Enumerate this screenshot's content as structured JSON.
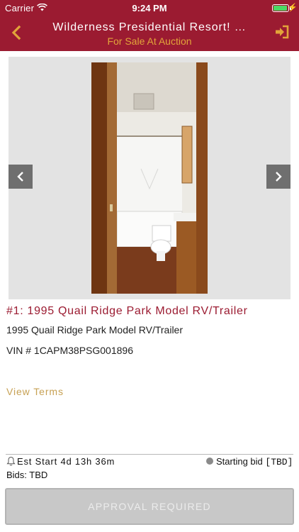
{
  "status_bar": {
    "carrier": "Carrier",
    "time": "9:24 PM"
  },
  "nav": {
    "title": "Wilderness Presidential Resort! …",
    "subtitle": "For Sale At Auction",
    "icons": {
      "back": "chevron-left-icon",
      "login": "sign-in-icon"
    }
  },
  "carousel": {
    "prev_icon": "chevron-left-icon",
    "next_icon": "chevron-right-icon",
    "photo": "bathroom-photo"
  },
  "lot": {
    "title": "#1: 1995 Quail Ridge Park Model RV/Trailer",
    "description": "1995 Quail Ridge Park Model RV/Trailer",
    "vin": "VIN # 1CAPM38PSG001896"
  },
  "view_terms": "View Terms",
  "auction": {
    "est_start": "Est Start 4d 13h 36m",
    "starting_bid_label": "Starting bid",
    "starting_bid_value": "[TBD]",
    "bids": "Bids: TBD"
  },
  "approval_button": "APPROVAL REQUIRED",
  "colors": {
    "brand": "#9b1b31",
    "accent": "#e2a43a",
    "link": "#c7a154",
    "disabled_button": "#c8c8c8"
  }
}
